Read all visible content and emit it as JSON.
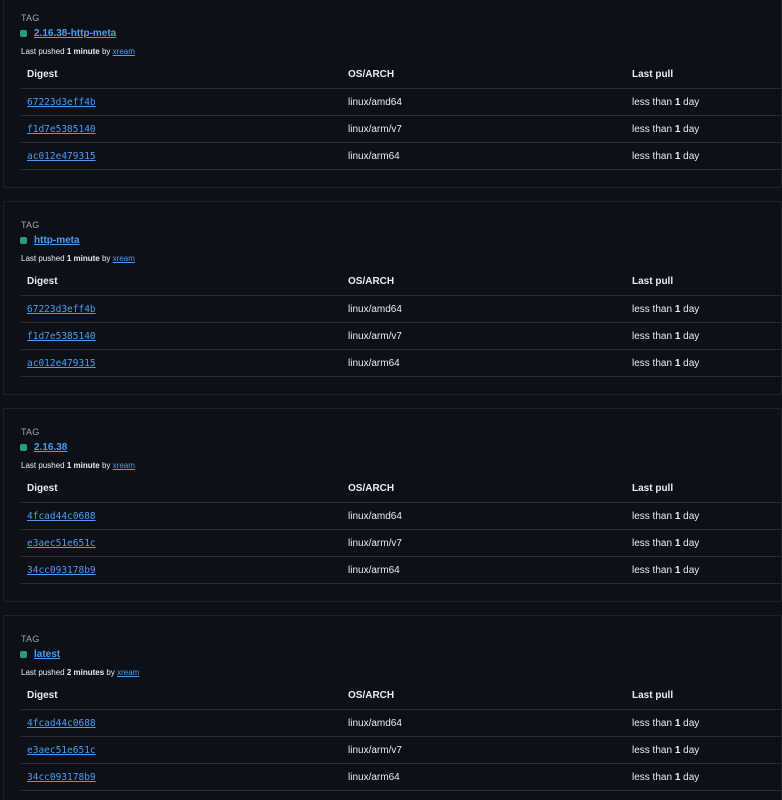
{
  "columns": {
    "digest": "Digest",
    "os_arch": "OS/ARCH",
    "last_pull": "Last pull"
  },
  "tags": [
    {
      "label": "TAG",
      "name": "2.16.38-http-meta",
      "pushed_prefix": "Last pushed",
      "pushed_ago": "1 minute",
      "pushed_by": "by",
      "user": "xream",
      "rows": [
        {
          "digest": "67223d3eff4b",
          "os_arch": "linux/amd64",
          "last_pull_pre": "less than",
          "last_pull_num": "1",
          "last_pull_post": "day"
        },
        {
          "digest": "f1d7e5385140",
          "os_arch": "linux/arm/v7",
          "last_pull_pre": "less than",
          "last_pull_num": "1",
          "last_pull_post": "day"
        },
        {
          "digest": "ac012e479315",
          "os_arch": "linux/arm64",
          "last_pull_pre": "less than",
          "last_pull_num": "1",
          "last_pull_post": "day"
        }
      ]
    },
    {
      "label": "TAG",
      "name": "http-meta",
      "pushed_prefix": "Last pushed",
      "pushed_ago": "1 minute",
      "pushed_by": "by",
      "user": "xream",
      "rows": [
        {
          "digest": "67223d3eff4b",
          "os_arch": "linux/amd64",
          "last_pull_pre": "less than",
          "last_pull_num": "1",
          "last_pull_post": "day"
        },
        {
          "digest": "f1d7e5385140",
          "os_arch": "linux/arm/v7",
          "last_pull_pre": "less than",
          "last_pull_num": "1",
          "last_pull_post": "day"
        },
        {
          "digest": "ac012e479315",
          "os_arch": "linux/arm64",
          "last_pull_pre": "less than",
          "last_pull_num": "1",
          "last_pull_post": "day"
        }
      ]
    },
    {
      "label": "TAG",
      "name": "2.16.38",
      "pushed_prefix": "Last pushed",
      "pushed_ago": "1 minute",
      "pushed_by": "by",
      "user": "xream",
      "rows": [
        {
          "digest": "4fcad44c0688",
          "os_arch": "linux/amd64",
          "last_pull_pre": "less than",
          "last_pull_num": "1",
          "last_pull_post": "day"
        },
        {
          "digest": "e3aec51e651c",
          "os_arch": "linux/arm/v7",
          "last_pull_pre": "less than",
          "last_pull_num": "1",
          "last_pull_post": "day"
        },
        {
          "digest": "34cc093178b9",
          "os_arch": "linux/arm64",
          "last_pull_pre": "less than",
          "last_pull_num": "1",
          "last_pull_post": "day"
        }
      ]
    },
    {
      "label": "TAG",
      "name": "latest",
      "pushed_prefix": "Last pushed",
      "pushed_ago": "2 minutes",
      "pushed_by": "by",
      "user": "xream",
      "rows": [
        {
          "digest": "4fcad44c0688",
          "os_arch": "linux/amd64",
          "last_pull_pre": "less than",
          "last_pull_num": "1",
          "last_pull_post": "day"
        },
        {
          "digest": "e3aec51e651c",
          "os_arch": "linux/arm/v7",
          "last_pull_pre": "less than",
          "last_pull_num": "1",
          "last_pull_post": "day"
        },
        {
          "digest": "34cc093178b9",
          "os_arch": "linux/arm64",
          "last_pull_pre": "less than",
          "last_pull_num": "1",
          "last_pull_post": "day"
        }
      ]
    }
  ],
  "colors": {
    "background": "#0d1117",
    "link": "#4d9bf0",
    "tag_dot": "#2a9a85"
  }
}
